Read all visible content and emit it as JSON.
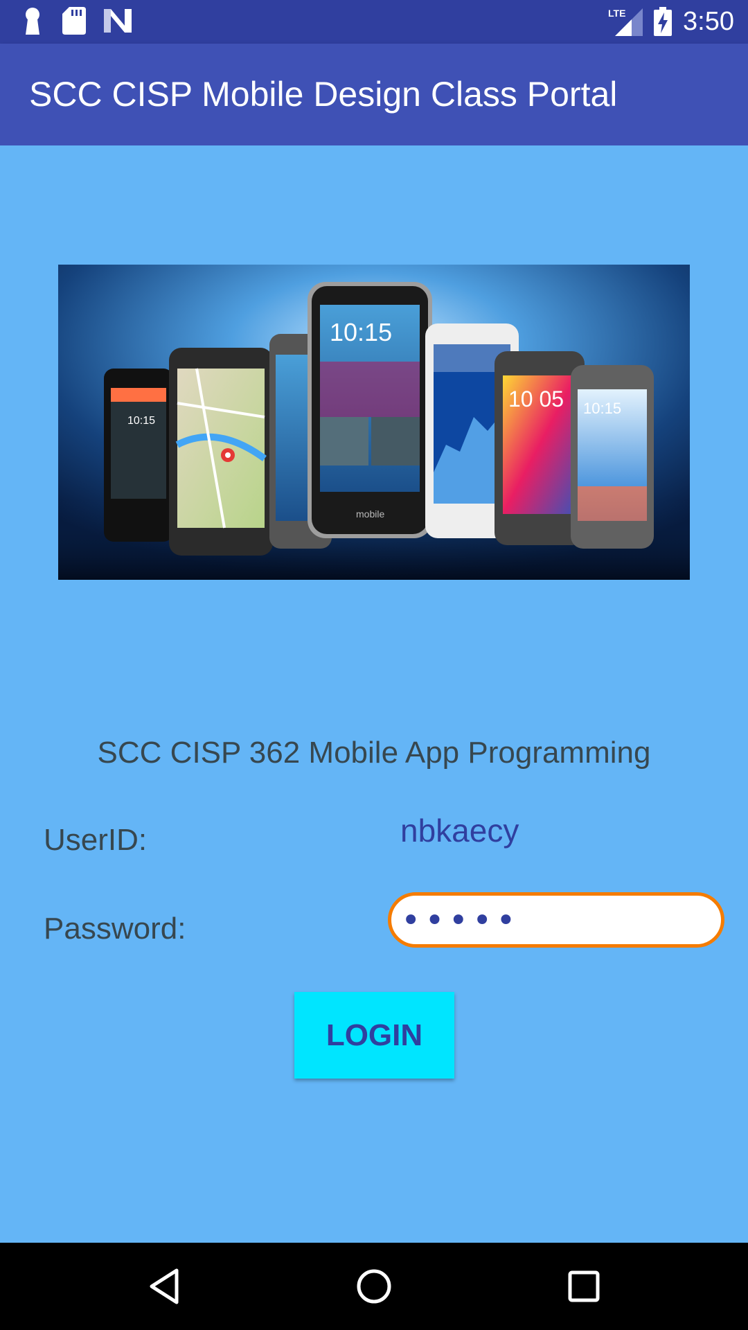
{
  "status_bar": {
    "time": "3:50",
    "network_label": "LTE",
    "icons": [
      "keyhole-icon",
      "sd-card-icon",
      "n-logo-icon",
      "lte-signal-icon",
      "battery-charging-icon"
    ]
  },
  "app_bar": {
    "title": "SCC CISP Mobile Design Class Portal"
  },
  "hero": {
    "image_name": "smartphones-image",
    "phone_times": [
      "10:15",
      "10:05",
      "10:15"
    ],
    "phone_brand": "mobile"
  },
  "form": {
    "course_title": "SCC CISP 362 Mobile App Programming",
    "user_label": "UserID:",
    "user_value": "nbkaecy",
    "password_label": "Password:",
    "password_value": "•••••",
    "login_label": "LOGIN"
  },
  "colors": {
    "status_bar": "#303f9f",
    "app_bar": "#3f51b5",
    "background": "#64b5f6",
    "accent_button": "#00e5ff",
    "focus_border": "#f57c00",
    "text_primary": "#303f9f"
  },
  "nav_bar": {
    "buttons": [
      "back-icon",
      "home-icon",
      "recents-icon"
    ]
  }
}
